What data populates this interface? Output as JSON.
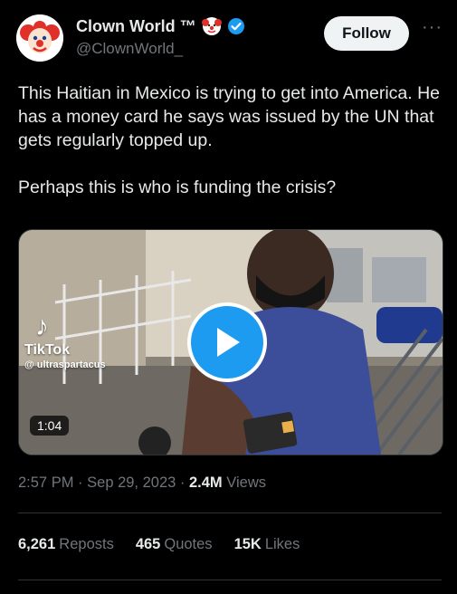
{
  "author": {
    "display_name": "Clown World ™",
    "handle": "@ClownWorld_",
    "name_emoji": "clown-face-icon",
    "verified_icon": "verified-badge-icon"
  },
  "follow_label": "Follow",
  "more_label": "···",
  "tweet": {
    "paragraph_1": "This Haitian in Mexico is trying to get into America. He has a money card he says was issued by the UN that gets regularly topped up.",
    "paragraph_2": "Perhaps this is who is funding the crisis?"
  },
  "video": {
    "watermark_brand": "TikTok",
    "watermark_user": "@ ultraspartacus",
    "duration": "1:04"
  },
  "meta": {
    "time": "2:57 PM",
    "separator": "·",
    "date": "Sep 29, 2023",
    "views_count": "2.4M",
    "views_label": "Views"
  },
  "stats": {
    "reposts_count": "6,261",
    "reposts_label": "Reposts",
    "quotes_count": "465",
    "quotes_label": "Quotes",
    "likes_count": "15K",
    "likes_label": "Likes"
  },
  "colors": {
    "background": "#000000",
    "text": "#e7e9ea",
    "muted": "#71767b",
    "accent": "#1d9bf0",
    "divider": "#2f3336"
  }
}
